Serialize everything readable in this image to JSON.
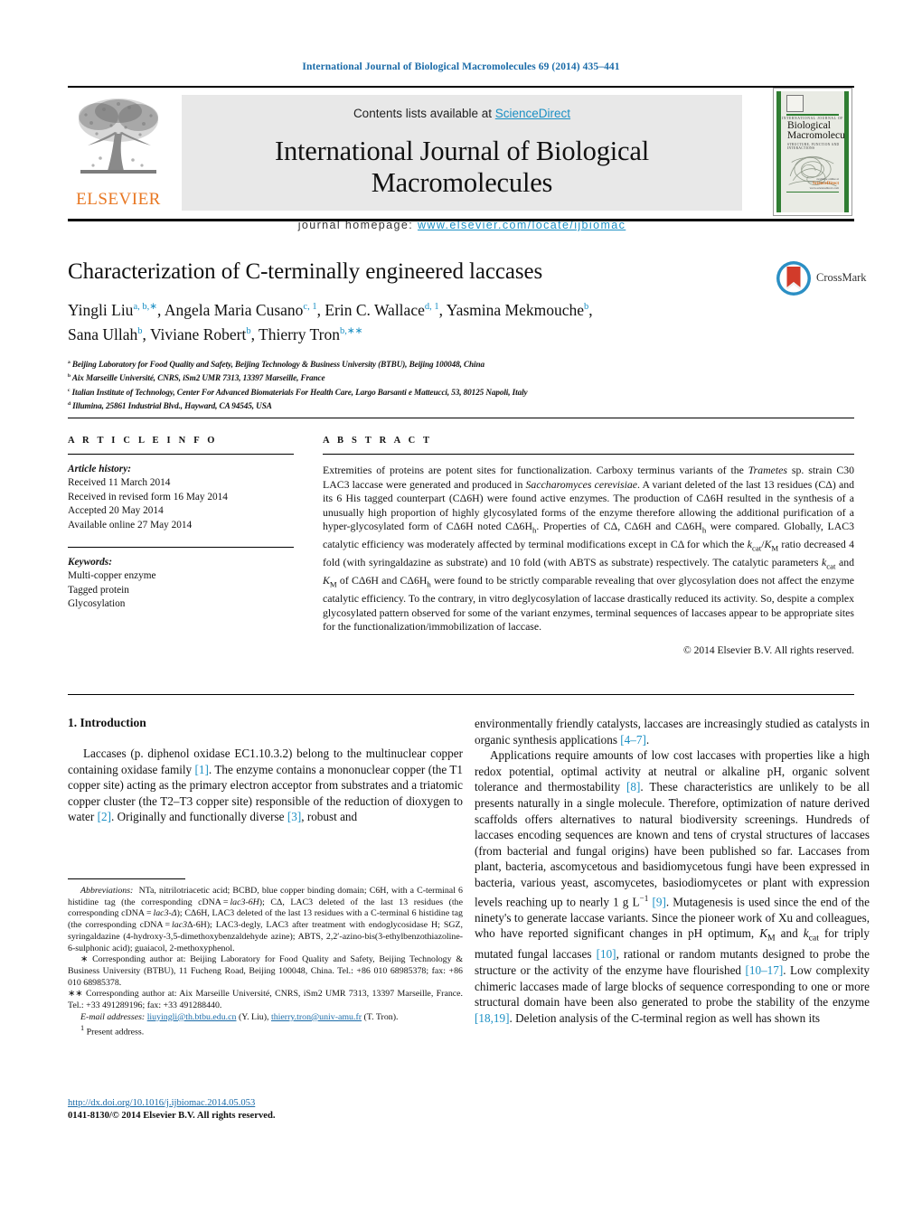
{
  "running_head": "International Journal of Biological Macromolecules 69 (2014) 435–441",
  "masthead": {
    "contents_prefix": "Contents lists available at ",
    "sciencedirect": "ScienceDirect",
    "journal_name": "International Journal of Biological Macromolecules",
    "homepage_prefix": "journal homepage: ",
    "homepage_url": "www.elsevier.com/locate/ijbiomac",
    "publisher": "ELSEVIER",
    "accent_orange": "#e87722",
    "accent_blue": "#1a8fc4"
  },
  "cover": {
    "kicker": "INTERNATIONAL JOURNAL OF",
    "title_line1": "Biological",
    "title_line2": "Macromolecules",
    "subtitle": "STRUCTURE, FUNCTION AND INTERACTIONS",
    "sd_label_small": "available online at",
    "sd_label": "ScienceDirect",
    "sd_sub": "www.sciencedirect.com",
    "border_green": "#2f7d32"
  },
  "article": {
    "title": "Characterization of C-terminally engineered laccases",
    "authors_line1": "Yingli Liu",
    "authors": [
      {
        "name": "Yingli Liu",
        "marks": "a, b,∗"
      },
      {
        "name": "Angela Maria Cusano",
        "marks": "c, 1"
      },
      {
        "name": "Erin C. Wallace",
        "marks": "d, 1"
      },
      {
        "name": "Yasmina Mekmouche",
        "marks": "b"
      },
      {
        "name": "Sana Ullah",
        "marks": "b"
      },
      {
        "name": "Viviane Robert",
        "marks": "b"
      },
      {
        "name": "Thierry Tron",
        "marks": "b,∗∗"
      }
    ],
    "affiliations": [
      {
        "mark": "a",
        "text": "Beijing Laboratory for Food Quality and Safety, Beijing Technology & Business University (BTBU), Beijing 100048, China"
      },
      {
        "mark": "b",
        "text": "Aix Marseille Université, CNRS, iSm2 UMR 7313, 13397 Marseille, France"
      },
      {
        "mark": "c",
        "text": "Italian Institute of Technology, Center For Advanced Biomaterials For Health Care, Largo Barsanti e Matteucci, 53, 80125 Napoli, Italy"
      },
      {
        "mark": "d",
        "text": "Illumina, 25861 Industrial Blvd., Hayward, CA 94545, USA"
      }
    ],
    "crossmark_label": "CrossMark"
  },
  "article_info": {
    "heading": "A R T I C L E    I N F O",
    "history_label": "Article history:",
    "history": [
      "Received 11 March 2014",
      "Received in revised form 16 May 2014",
      "Accepted 20 May 2014",
      "Available online 27 May 2014"
    ],
    "keywords_label": "Keywords:",
    "keywords": [
      "Multi-copper enzyme",
      "Tagged protein",
      "Glycosylation"
    ]
  },
  "abstract": {
    "heading": "A B S T R A C T",
    "copyright": "© 2014 Elsevier B.V. All rights reserved."
  },
  "introduction": {
    "heading": "1. Introduction",
    "left_paragraph_1": "Laccases (p. diphenol oxidase EC1.10.3.2) belong to the multinuclear copper containing oxidase family [1]. The enzyme contains a mononuclear copper (the T1 copper site) acting as the primary electron acceptor from substrates and a triatomic copper cluster (the T2–T3 copper site) responsible of the reduction of dioxygen to water [2]. Originally and functionally diverse [3], robust and",
    "right_paragraph_1": "environmentally friendly catalysts, laccases are increasingly studied as catalysts in organic synthesis applications [4–7]."
  },
  "footnotes": {
    "abbreviations_label": "Abbreviations:",
    "corresponding_1": "Corresponding author at: Beijing Laboratory for Food Quality and Safety, Beijing Technology & Business University (BTBU), 11 Fucheng Road, Beijing 100048, China. Tel.: +86 010 68985378; fax: +86 010 68985378.",
    "corresponding_2": "Corresponding author at: Aix Marseille Université, CNRS, iSm2 UMR 7313, 13397 Marseille, France. Tel.: +33 491289196; fax: +33 491288440.",
    "email_label": "E-mail addresses:",
    "email_1": "liuyingli@th.btbu.edu.cn",
    "email_1_owner": "(Y. Liu),",
    "email_2": "thierry.tron@univ-amu.fr",
    "email_2_owner": "(T. Tron).",
    "present_address": "Present address."
  },
  "doi": {
    "url": "http://dx.doi.org/10.1016/j.ijbiomac.2014.05.053",
    "issn_line": "0141-8130/© 2014 Elsevier B.V. All rights reserved."
  }
}
